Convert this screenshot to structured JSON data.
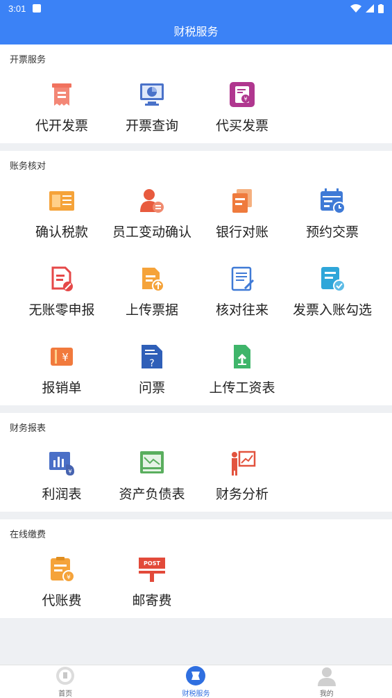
{
  "status": {
    "time": "3:01"
  },
  "header": {
    "title": "财税服务"
  },
  "sections": [
    {
      "title": "开票服务",
      "items": [
        {
          "label": "代开发票",
          "icon": "receipt-icon",
          "color": "#f1725e"
        },
        {
          "label": "开票查询",
          "icon": "monitor-chart-icon",
          "color": "#4a72c9"
        },
        {
          "label": "代买发票",
          "icon": "invoice-yen-icon",
          "color": "#b0378f"
        }
      ]
    },
    {
      "title": "账务核对",
      "items": [
        {
          "label": "确认税款",
          "icon": "tax-card-icon",
          "color": "#f5a33a"
        },
        {
          "label": "员工变动确认",
          "icon": "employee-change-icon",
          "color": "#e85b3e"
        },
        {
          "label": "银行对账",
          "icon": "bank-docs-icon",
          "color": "#ef7b3d"
        },
        {
          "label": "预约交票",
          "icon": "calendar-clock-icon",
          "color": "#3f7ad6"
        },
        {
          "label": "无账零申报",
          "icon": "doc-forbid-icon",
          "color": "#e54848"
        },
        {
          "label": "上传票据",
          "icon": "doc-upload-icon",
          "color": "#f5a33a"
        },
        {
          "label": "核对往来",
          "icon": "doc-edit-icon",
          "color": "#3f7ad6"
        },
        {
          "label": "发票入账勾选",
          "icon": "doc-check-icon",
          "color": "#2fa6d9"
        },
        {
          "label": "报销单",
          "icon": "ticket-yen-icon",
          "color": "#f17a3d"
        },
        {
          "label": "问票",
          "icon": "doc-question-icon",
          "color": "#2f5fb8"
        },
        {
          "label": "上传工资表",
          "icon": "sheet-upload-icon",
          "color": "#3fb56a"
        }
      ]
    },
    {
      "title": "财务报表",
      "items": [
        {
          "label": "利润表",
          "icon": "profit-chart-icon",
          "color": "#4a6fc7"
        },
        {
          "label": "资产负债表",
          "icon": "balance-sheet-icon",
          "color": "#5aae5e"
        },
        {
          "label": "财务分析",
          "icon": "presenter-chart-icon",
          "color": "#e2533e"
        }
      ]
    },
    {
      "title": "在线缴费",
      "items": [
        {
          "label": "代账费",
          "icon": "fee-doc-icon",
          "color": "#f5a33a"
        },
        {
          "label": "邮寄费",
          "icon": "post-sign-icon",
          "color": "#e24a3a",
          "sign_text": "POST"
        }
      ]
    }
  ],
  "tabs": [
    {
      "label": "首页",
      "icon": "home-icon",
      "active": false
    },
    {
      "label": "财税服务",
      "icon": "service-icon",
      "active": true
    },
    {
      "label": "我的",
      "icon": "user-icon",
      "active": false
    }
  ],
  "colors": {
    "primary": "#3b82f6",
    "tab_active": "#2f6fe0"
  }
}
